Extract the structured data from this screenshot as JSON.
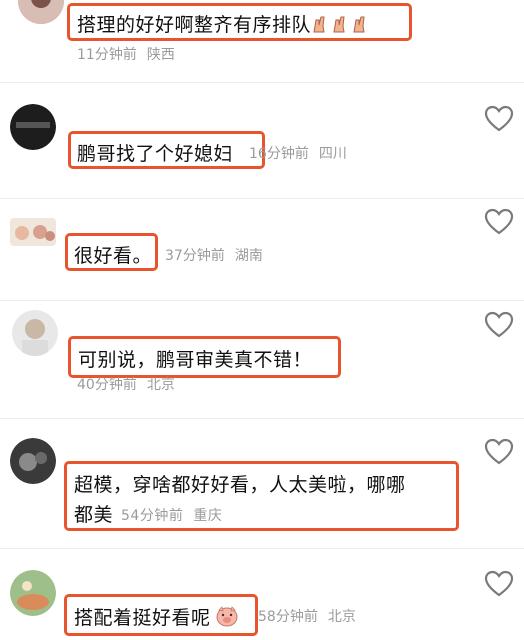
{
  "accent_color": "#e8542e",
  "comments": [
    {
      "text": "搭理的好好啊整齐有序排队",
      "emoji": "✌",
      "time": "11分钟前",
      "location": "陕西"
    },
    {
      "text": "鹏哥找了个好媳妇",
      "time": "16分钟前",
      "location": "四川"
    },
    {
      "text": "很好看。",
      "time": "37分钟前",
      "location": "湖南"
    },
    {
      "text": "可别说，鹏哥审美真不错！",
      "time": "40分钟前",
      "location": "北京"
    },
    {
      "text": "超模，穿啥都好好看，人太美啦，哪哪",
      "text2": "都美",
      "time": "54分钟前",
      "location": "重庆"
    },
    {
      "text": "搭配着挺好看呢",
      "emoji": "pig-face",
      "time": "58分钟前",
      "location": "北京"
    }
  ]
}
